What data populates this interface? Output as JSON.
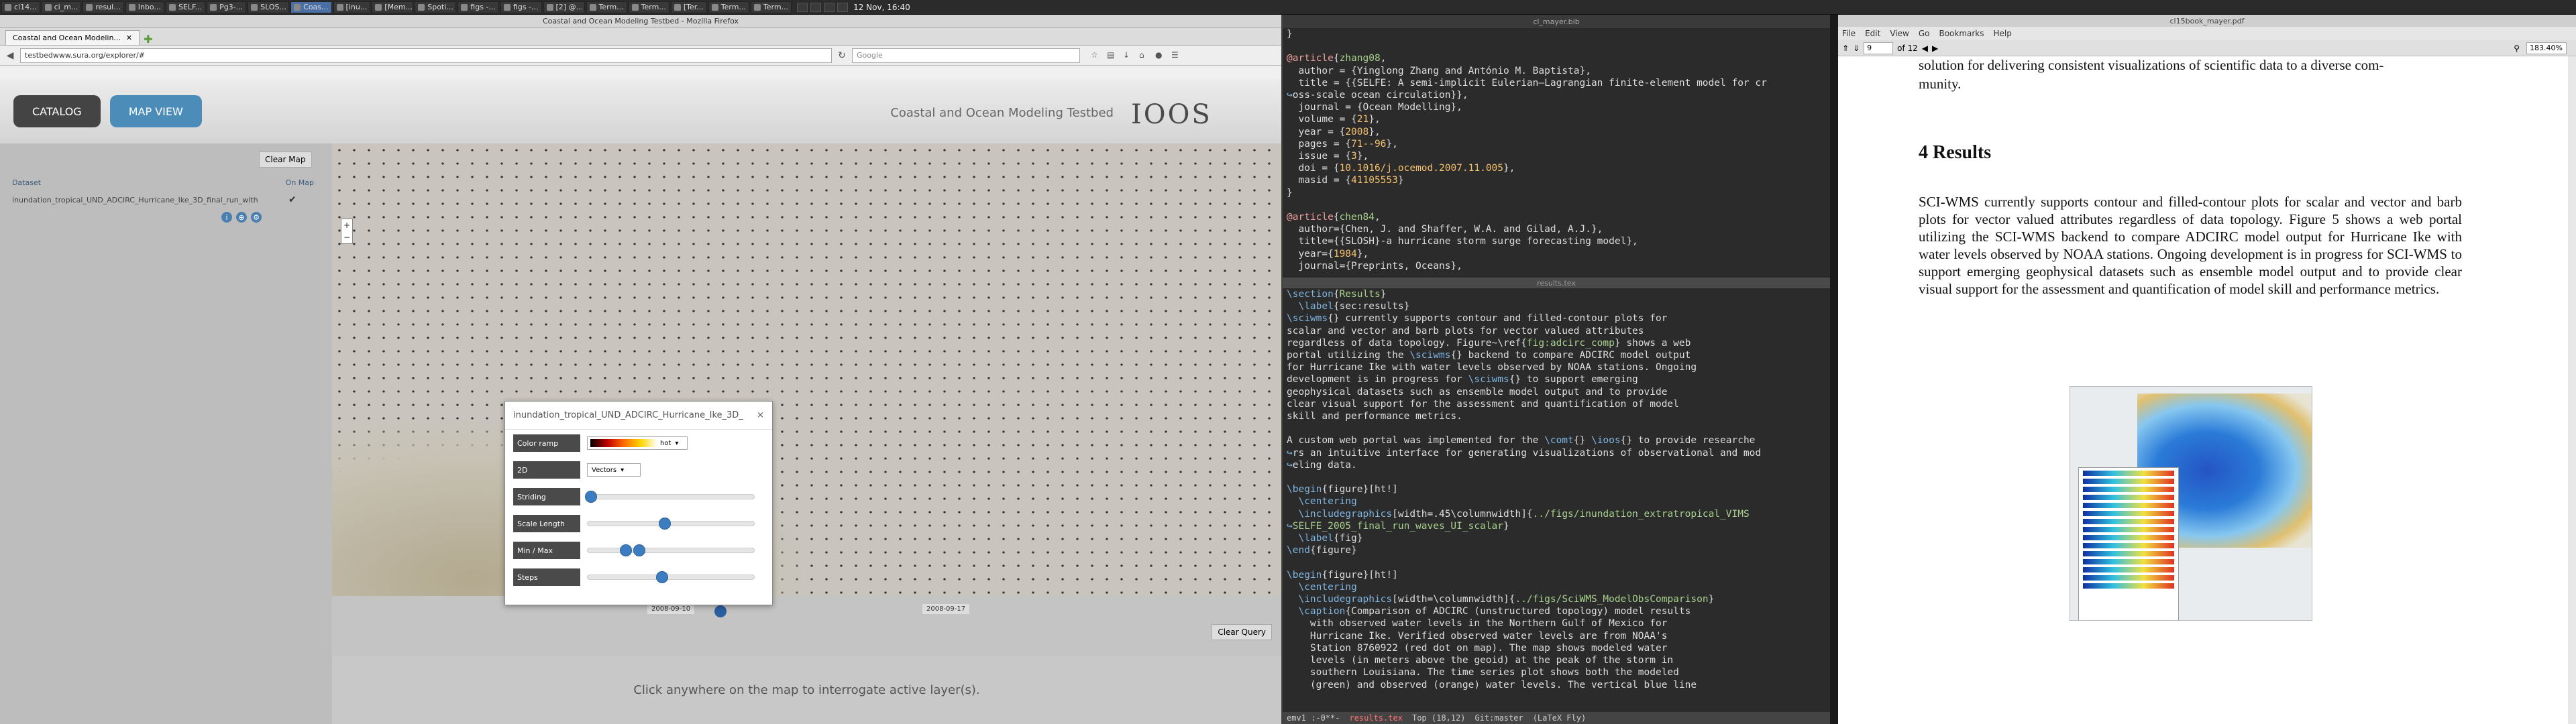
{
  "taskbar": {
    "tasks": [
      "cl14...",
      "ci_m...",
      "resul...",
      "Inbo...",
      "SELF...",
      "Pg3-...",
      "SLOS...",
      "Coas...",
      "[inu...",
      "[Mem...",
      "Spoti...",
      "figs -...",
      "figs -...",
      "[2] @...",
      "Term...",
      "Term...",
      "[Ter...",
      "Term...",
      "Term..."
    ],
    "clock": "12 Nov, 16:40"
  },
  "firefox": {
    "window_title": "Coastal and Ocean Modeling Testbed - Mozilla Firefox",
    "tab_label": "Coastal and Ocean Modelin...",
    "url": "testbedwww.sura.org/explorer/#",
    "search_placeholder": "Google",
    "page": {
      "catalog_label": "CATALOG",
      "mapview_label": "MAP VIEW",
      "site_title": "Coastal and Ocean Modeling Testbed",
      "logo_text": "IOOS",
      "clear_map": "Clear Map",
      "dataset_col": "Dataset",
      "onmap_col": "On Map",
      "dataset_name": "inundation_tropical_UND_ADCIRC_Hurricane_Ike_3D_final_run_with",
      "date_left": "2008-09-10",
      "date_right": "2008-09-17",
      "clear_query": "Clear Query",
      "info_text": "Click anywhere on the map to interrogate active layer(s).",
      "dialog": {
        "title": "inundation_tropical_UND_ADCIRC_Hurricane_Ike_3D_",
        "color_ramp_label": "Color ramp",
        "color_ramp_value": "hot",
        "mode_label": "2D",
        "mode_value": "Vectors",
        "striding_label": "Striding",
        "scale_label": "Scale Length",
        "minmax_label": "Min / Max",
        "steps_label": "Steps"
      }
    }
  },
  "emacs": {
    "top_title": "cl_mayer.bib",
    "bottom_title": "results.tex",
    "modeline": {
      "left": "emv1 :-0**-",
      "filename": "results.tex",
      "position": "Top (18,12)",
      "branch": "Git:master",
      "mode": "(LaTeX Fly)"
    }
  },
  "pdf": {
    "window_title": "cl15book_mayer.pdf",
    "menu": [
      "File",
      "Edit",
      "View",
      "Go",
      "Bookmarks",
      "Help"
    ],
    "page_number": "9",
    "page_total": "of 12",
    "zoom": "183.40%",
    "prev_text_1": "solution for delivering consistent visualizations of scientific data to a diverse com-",
    "prev_text_2": "munity.",
    "section_heading": "4 Results",
    "paragraph": "SCI-WMS currently supports contour and filled-contour plots for scalar and vector and barb plots for vector valued attributes regardless of data topology. Figure 5 shows a web portal utilizing the SCI-WMS backend to compare ADCIRC model output for Hurricane Ike with water levels observed by NOAA stations. Ongoing development is in progress for SCI-WMS to support emerging geophysical datasets such as ensemble model output and to provide clear visual support for the assessment and quantification of model skill and performance metrics."
  },
  "colors": {
    "catalog_bg": "#444444",
    "mapview_bg": "#4b8db8",
    "slider_knob": "#3c7cc0",
    "emacs_bg": "#2b2b2b"
  }
}
